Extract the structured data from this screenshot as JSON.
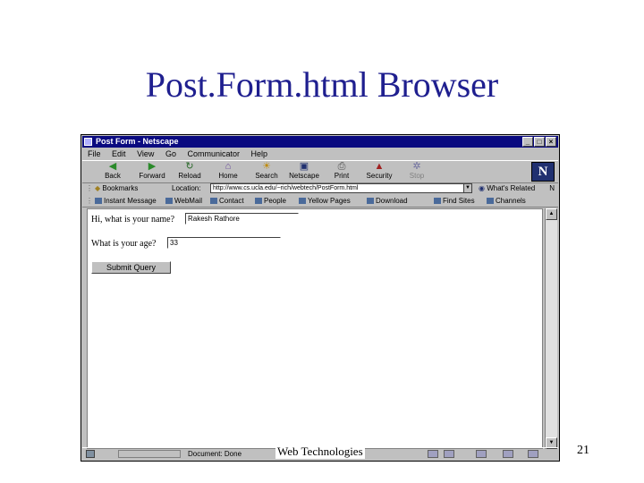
{
  "slide": {
    "title": "Post.Form.html Browser",
    "footer": "Web Technologies",
    "page_number": "21"
  },
  "window": {
    "title": "Post Form - Netscape",
    "controls": [
      "minimize-icon",
      "maximize-icon",
      "close-icon"
    ]
  },
  "menu": [
    "File",
    "Edit",
    "View",
    "Go",
    "Communicator",
    "Help"
  ],
  "toolbar": [
    {
      "label": "Back",
      "icon": "back-arrow-icon"
    },
    {
      "label": "Forward",
      "icon": "forward-arrow-icon"
    },
    {
      "label": "Reload",
      "icon": "reload-icon"
    },
    {
      "label": "Home",
      "icon": "home-icon"
    },
    {
      "label": "Search",
      "icon": "search-icon"
    },
    {
      "label": "Netscape",
      "icon": "netscape-icon"
    },
    {
      "label": "Print",
      "icon": "print-icon"
    },
    {
      "label": "Security",
      "icon": "security-icon"
    },
    {
      "label": "Stop",
      "icon": "stop-icon",
      "disabled": true
    }
  ],
  "location": {
    "bookmarks_label": "Bookmarks",
    "field_label": "Location:",
    "url": "http://www.cs.ucla.edu/~rich/webtech/PostForm.html",
    "whats_related": "What's Related"
  },
  "personal_toolbar": [
    "Instant Message",
    "WebMail",
    "Contact",
    "People",
    "Yellow Pages",
    "Download",
    "Find Sites",
    "Channels"
  ],
  "form": {
    "name_label": "Hi, what is your name?",
    "name_value": "Rakesh Rathore",
    "age_label": "What is your age?",
    "age_value": "33",
    "submit_label": "Submit Query"
  },
  "status": {
    "text": "Document: Done"
  },
  "colors": {
    "title_blue": "#1f1f8f",
    "titlebar": "#0a0a80",
    "chrome_gray": "#c0c0c0"
  }
}
